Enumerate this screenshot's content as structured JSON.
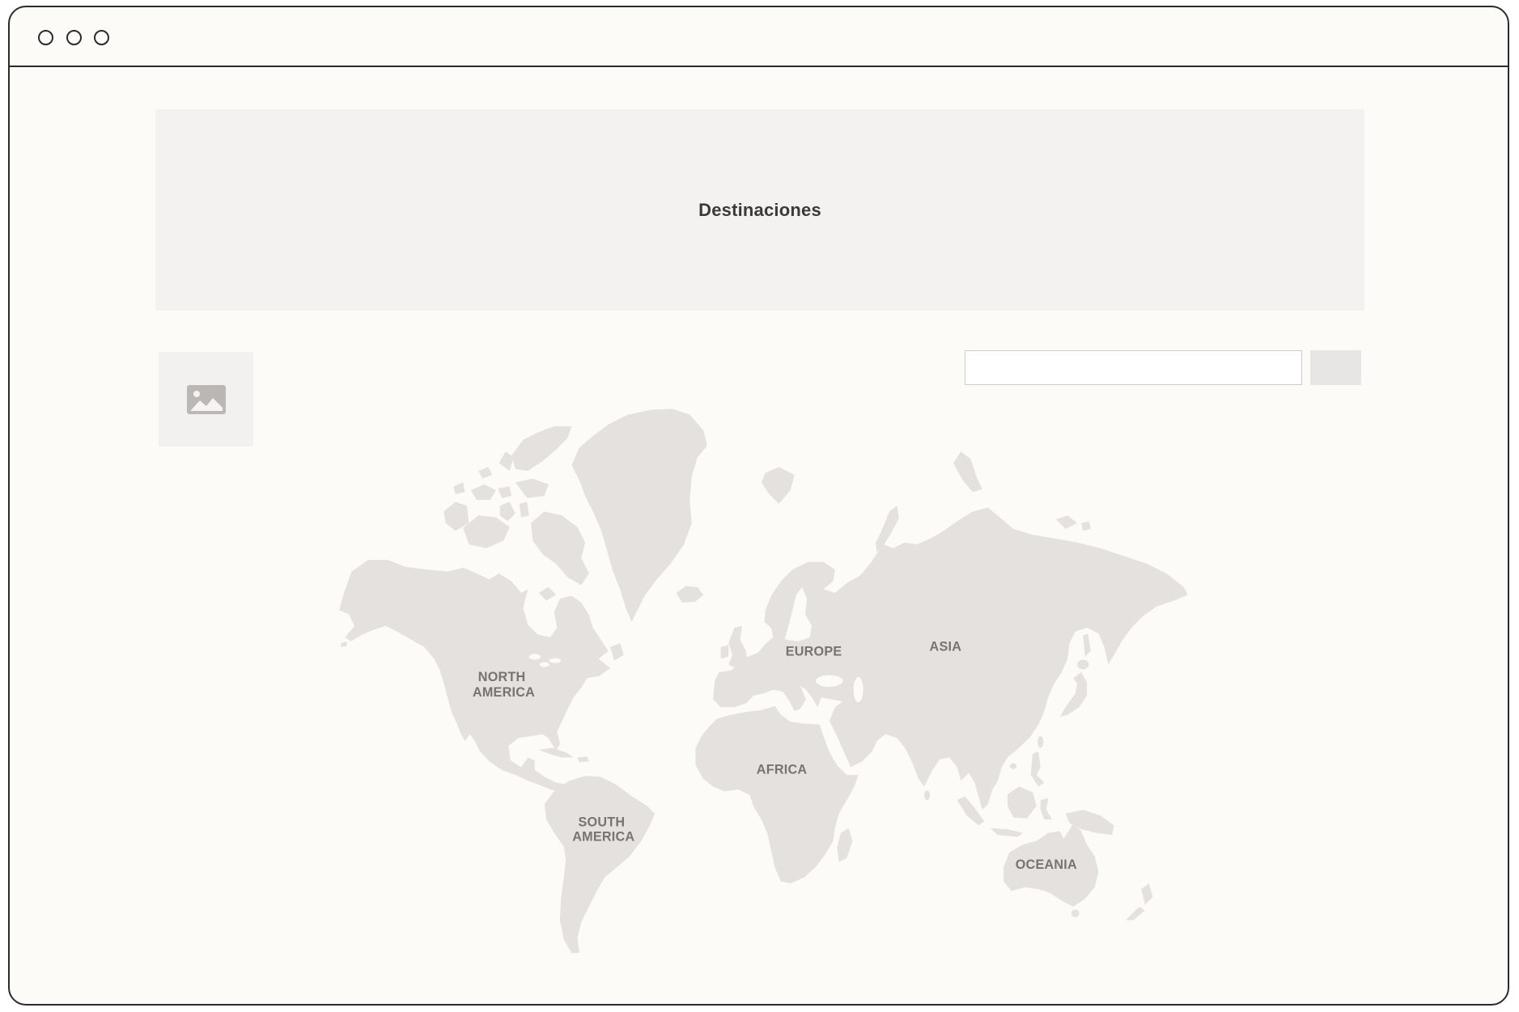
{
  "window": {
    "controls": [
      "circle-icon",
      "circle-icon",
      "circle-icon"
    ]
  },
  "hero": {
    "title": "Destinaciones"
  },
  "media_placeholder": {
    "icon": "image-icon"
  },
  "search": {
    "value": "",
    "placeholder": "",
    "button_label": ""
  },
  "map": {
    "regions": {
      "north_america": {
        "label_lines": [
          "NORTH",
          "AMERICA"
        ]
      },
      "south_america": {
        "label_lines": [
          "SOUTH",
          "AMERICA"
        ]
      },
      "europe": {
        "label_lines": [
          "EUROPE"
        ]
      },
      "asia": {
        "label_lines": [
          "ASIA"
        ]
      },
      "africa": {
        "label_lines": [
          "AFRICA"
        ]
      },
      "oceania": {
        "label_lines": [
          "OCEANIA"
        ]
      }
    }
  },
  "colors": {
    "page_bg": "#ffffff",
    "window_bg": "#fdfbf8",
    "frame": "#2b2b2b",
    "banner_bg": "#f4f2f0",
    "title_text": "#3a3a3a",
    "placeholder_bg": "#f3f1ef",
    "placeholder_icon": "#bab7b4",
    "input_border": "#cfccc9",
    "input_bg": "#ffffff",
    "button_bg": "#e8e6e4",
    "land": "#e4e1de",
    "map_label": "#77736f"
  }
}
